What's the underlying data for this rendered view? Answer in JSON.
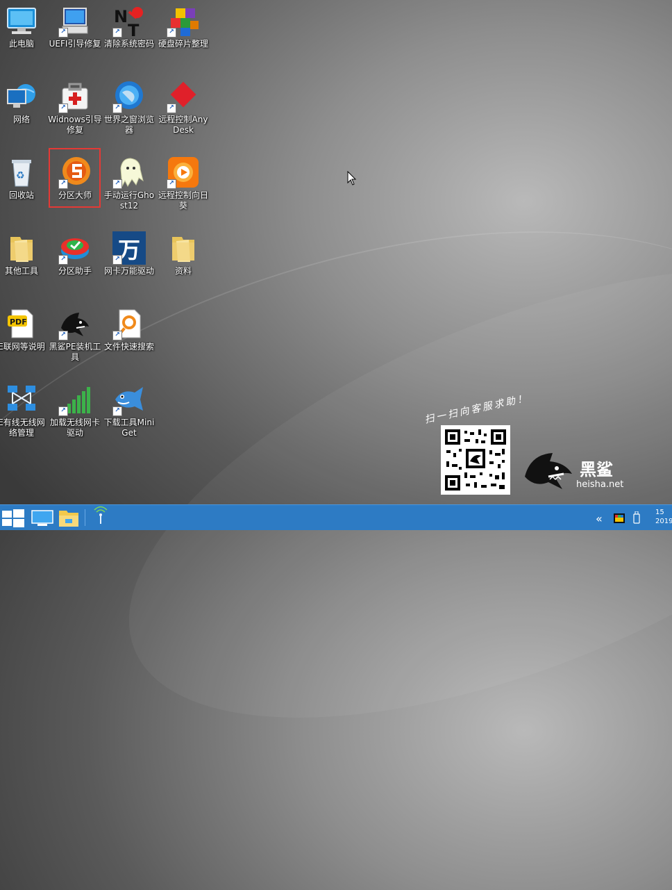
{
  "desktop": {
    "icons": [
      {
        "label": "此电脑",
        "icon": "computer-icon"
      },
      {
        "label": "UEFI引导修复",
        "icon": "computer-repair-icon"
      },
      {
        "label": "清除系统密码",
        "icon": "nt-password-icon"
      },
      {
        "label": "硬盘碎片整理",
        "icon": "defrag-cubes-icon"
      },
      {
        "label": "网络",
        "icon": "network-globe-icon"
      },
      {
        "label": "Widnows引导修复",
        "icon": "first-aid-kit-icon"
      },
      {
        "label": "世界之窗浏览器",
        "icon": "browser-globe-icon"
      },
      {
        "label": "远程控制AnyDesk",
        "icon": "anydesk-icon"
      },
      {
        "label": "回收站",
        "icon": "recycle-bin-icon"
      },
      {
        "label": "分区大师",
        "icon": "partition-master-icon"
      },
      {
        "label": "手动运行Ghost12",
        "icon": "ghost-icon"
      },
      {
        "label": "远程控制向日葵",
        "icon": "sunflower-icon"
      },
      {
        "label": "其他工具",
        "icon": "folder-icon"
      },
      {
        "label": "分区助手",
        "icon": "partition-assistant-icon"
      },
      {
        "label": "网卡万能驱动",
        "icon": "wan-driver-icon"
      },
      {
        "label": "资料",
        "icon": "folder-icon"
      },
      {
        "label": "E联网等说明",
        "icon": "pdf-icon"
      },
      {
        "label": "黑鲨PE装机工具",
        "icon": "shark-icon"
      },
      {
        "label": "文件快速搜索",
        "icon": "file-search-icon"
      },
      {
        "label": "E有线无线网络管理",
        "icon": "network-manager-icon"
      },
      {
        "label": "加载无线网卡驱动",
        "icon": "wifi-bars-icon"
      },
      {
        "label": "下载工具MiniGet",
        "icon": "fish-icon"
      }
    ],
    "selected": "分区大师"
  },
  "promo": {
    "tagline": "扫一扫向客服求助！",
    "brand": "黑鲨",
    "url": "heisha.net"
  },
  "taskbar": {
    "clock_line1": "15",
    "clock_line2": "2019",
    "chevron": "«"
  },
  "colors": {
    "taskbar": "#2d7bc4",
    "selection": "#e53935"
  }
}
